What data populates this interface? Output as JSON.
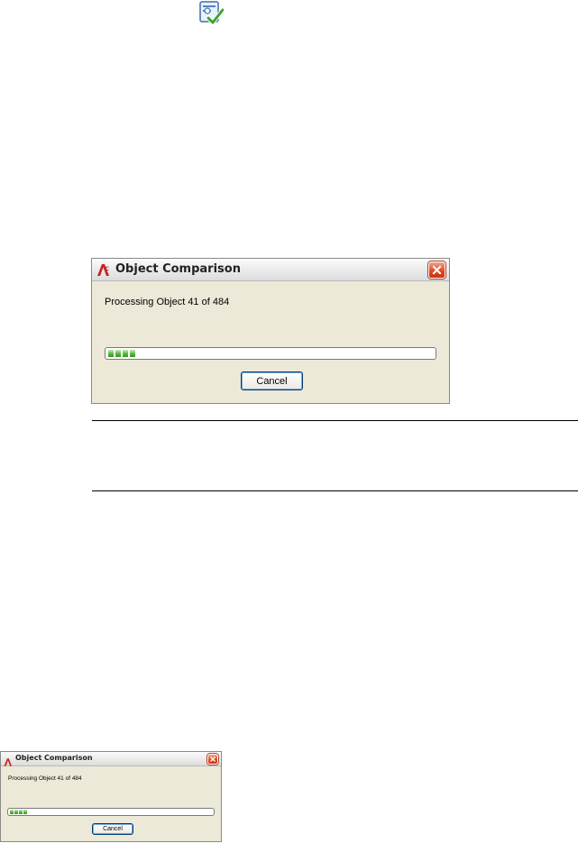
{
  "top_icon": "compare-check-icon",
  "dialogs": {
    "large": {
      "title": "Object Comparison",
      "message": "Processing Object 41 of 484",
      "progress": {
        "blocks_filled": 4,
        "fraction": 0.085
      },
      "cancel_label": "Cancel",
      "app_icon": "autocad-logo-icon",
      "close_icon": "close-icon"
    },
    "small": {
      "title": "Object Comparison",
      "message": "Processing Object 41 of 484",
      "progress": {
        "blocks_filled": 4,
        "fraction": 0.085
      },
      "cancel_label": "Cancel",
      "app_icon": "autocad-logo-icon",
      "close_icon": "close-icon"
    }
  },
  "colors": {
    "dialog_bg": "#ece9d8",
    "close_red": "#e04a22",
    "progress_green": "#52b336",
    "button_border": "#003c74"
  }
}
